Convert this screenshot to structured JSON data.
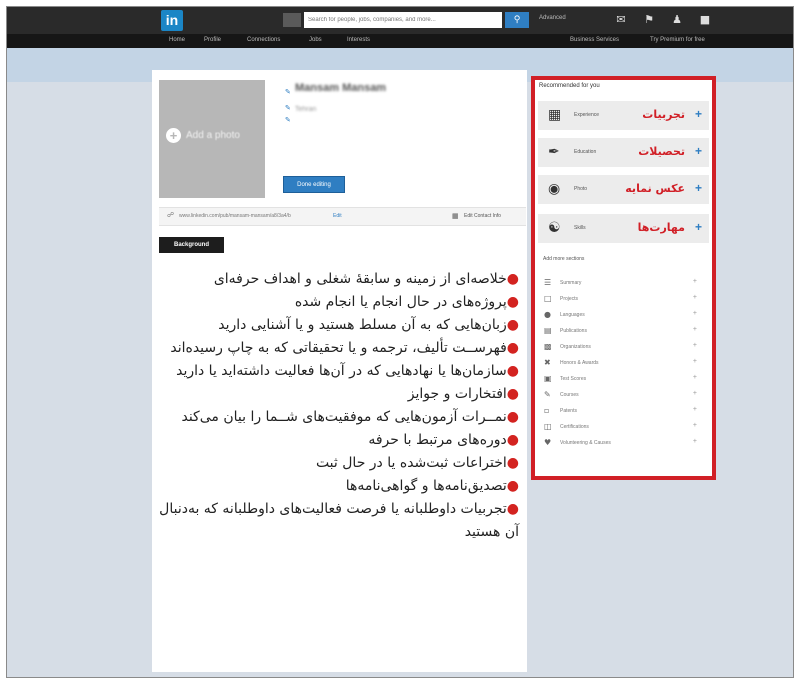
{
  "topbar": {
    "logo": "in",
    "search_placeholder": "Search for people, jobs, companies, and more...",
    "search_icon": "search-icon",
    "advanced": "Advanced",
    "icons": [
      "inbox-icon",
      "flag-icon",
      "add-connection-icon",
      "account-icon"
    ]
  },
  "nav": {
    "items": [
      "Home",
      "Profile",
      "Connections",
      "Jobs",
      "Interests"
    ],
    "right": [
      "Business Services",
      "Try Premium for free"
    ]
  },
  "profile": {
    "add_photo": "Add a photo",
    "name": "Mansam Mansam",
    "headline": "Tehran",
    "done_editing": "Done editing",
    "url": "www.linkedin.com/pub/mansam-mansam/a8/3a4/b",
    "url_edit": "Edit",
    "contact_info": "Edit Contact Info",
    "background_tab": "Background"
  },
  "features": [
    "خلاصه‌ای از زمینه و سابقهٔ شغلی و اهداف حرفه‌ای",
    "پروژه‌های در حال انجام یا انجام شده",
    "زبان‌هایی که به آن مسلط هستید و یا آشنایی دارید",
    "فهرســت تألیف، ترجمه و یا تحقیقاتی که به چاپ رسیده‌اند",
    "سازمان‌ها یا نهادهایی که در آن‌ها فعالیت داشته‌اید یا دارید",
    "افتخارات و جوایز",
    "نمــرات آزمون‌هایی که موفقیت‌های شــما را بیان می‌کند",
    "دوره‌های مرتبط با حرفه",
    "اختراعات ثبت‌شده یا در حال ثبت",
    "تصدیق‌نامه‌ها و گواهی‌نامه‌ها",
    "تجربیات داوطلبانه یا فرصت فعالیت‌های داوطلبانه که به‌دنبال آن هستید"
  ],
  "recommended": {
    "title": "Recommended for you",
    "items": [
      {
        "en": "Experience",
        "fa": "تجربیات",
        "icon": "briefcase-icon"
      },
      {
        "en": "Education",
        "fa": "تحصیلات",
        "icon": "graduation-icon"
      },
      {
        "en": "Photo",
        "fa": "عکس نمایه",
        "icon": "camera-icon"
      },
      {
        "en": "Skills",
        "fa": "مهارت‌ها",
        "icon": "skills-icon"
      }
    ],
    "more_title": "Add more sections",
    "sections": [
      {
        "label": "Summary",
        "icon": "summary-icon"
      },
      {
        "label": "Projects",
        "icon": "projects-icon"
      },
      {
        "label": "Languages",
        "icon": "languages-icon"
      },
      {
        "label": "Publications",
        "icon": "publications-icon"
      },
      {
        "label": "Organizations",
        "icon": "organizations-icon"
      },
      {
        "label": "Honors & Awards",
        "icon": "honors-icon"
      },
      {
        "label": "Test Scores",
        "icon": "test-scores-icon"
      },
      {
        "label": "Courses",
        "icon": "courses-icon"
      },
      {
        "label": "Patents",
        "icon": "patents-icon"
      },
      {
        "label": "Certifications",
        "icon": "certifications-icon"
      },
      {
        "label": "Volunteering & Causes",
        "icon": "volunteering-icon"
      }
    ]
  }
}
